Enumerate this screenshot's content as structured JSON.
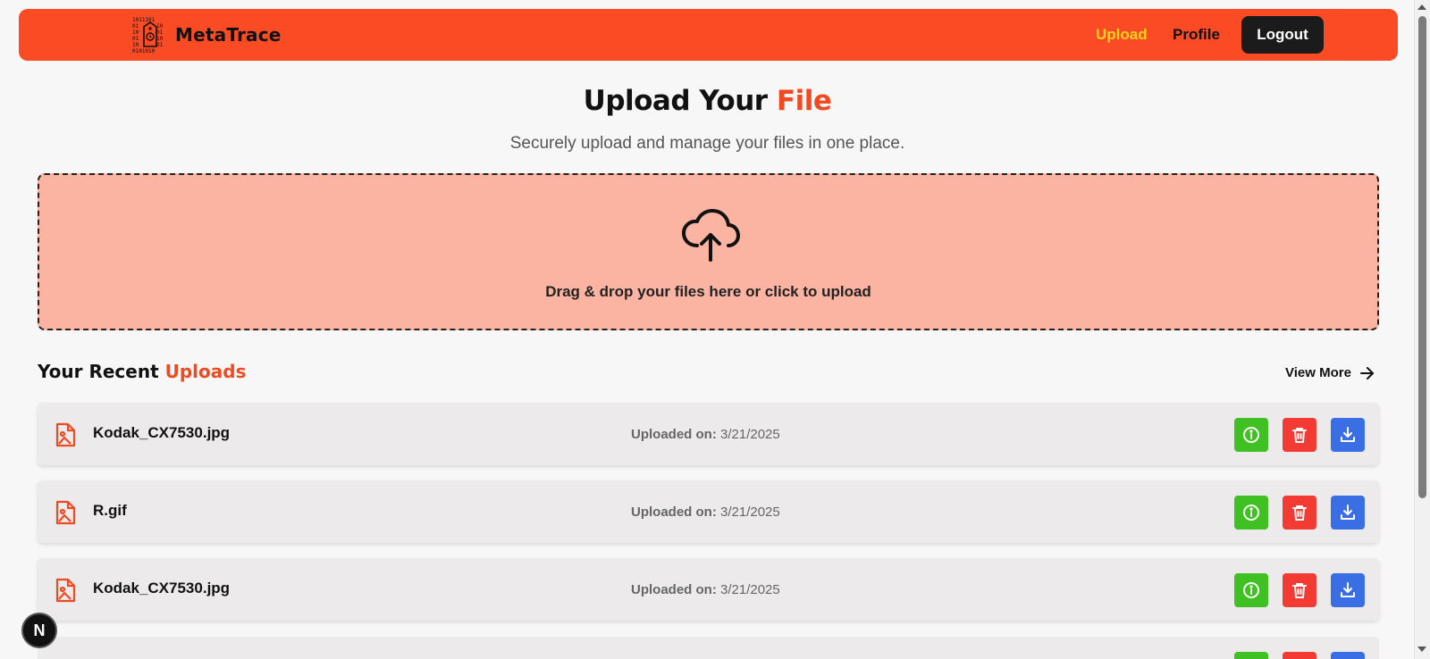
{
  "header": {
    "brand": "MetaTrace",
    "nav": {
      "upload": "Upload",
      "profile": "Profile"
    },
    "logout_label": "Logout"
  },
  "hero": {
    "title_main": "Upload Your ",
    "title_accent": "File",
    "subtitle": "Securely upload and manage your files in one place."
  },
  "dropzone": {
    "text": "Drag & drop your files here or click to upload",
    "icon": "cloud-upload-icon"
  },
  "recent": {
    "title_main": "Your Recent ",
    "title_accent": "Uploads",
    "view_more": "View More",
    "date_label": "Uploaded on:",
    "files": [
      {
        "name": "Kodak_CX7530.jpg",
        "date": "3/21/2025"
      },
      {
        "name": "R.gif",
        "date": "3/21/2025"
      },
      {
        "name": "Kodak_CX7530.jpg",
        "date": "3/21/2025"
      }
    ]
  },
  "badge": {
    "letter": "N"
  },
  "colors": {
    "brand": "#fa4b24",
    "accent": "#f04a22",
    "nav_active": "#ffd21f",
    "dropzone_bg": "#fbb3a2",
    "info": "#3fc023",
    "delete": "#f33b34",
    "download": "#3a6ee4"
  }
}
